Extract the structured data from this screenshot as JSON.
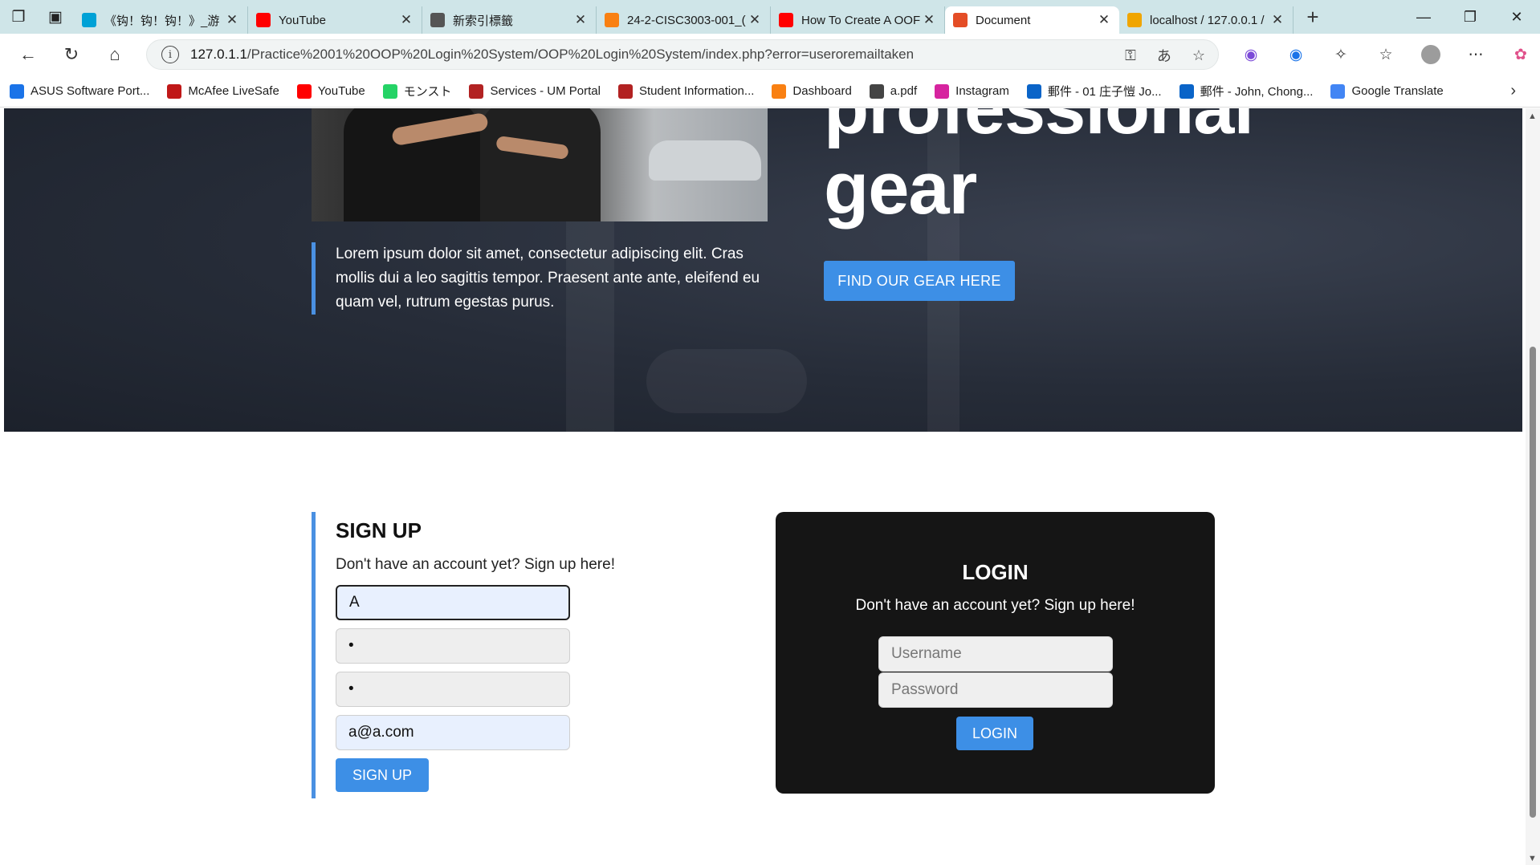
{
  "browser": {
    "tabs": [
      {
        "title": "《钩！钩！钩！》_游",
        "favicon": "bilibili-icon",
        "color": "#00a1d6"
      },
      {
        "title": "YouTube",
        "favicon": "youtube-icon",
        "color": "#ff0000"
      },
      {
        "title": "新索引標籤",
        "favicon": "newtab-icon",
        "color": "#555555"
      },
      {
        "title": "24-2-CISC3003-001_(",
        "favicon": "moodle-icon",
        "color": "#f98012"
      },
      {
        "title": "How To Create A OOF",
        "favicon": "youtube-icon",
        "color": "#ff0000"
      },
      {
        "title": "Document",
        "favicon": "html-icon",
        "color": "#e44d26"
      },
      {
        "title": "localhost / 127.0.0.1 /",
        "favicon": "phpmyadmin-icon",
        "color": "#f0a500"
      }
    ],
    "active_tab_index": 5,
    "url_host": "127.0.1.1",
    "url_path": "/Practice%2001%20OOP%20Login%20System/OOP%20Login%20System/index.php?error=useroremailtaken",
    "bookmarks": [
      {
        "label": "ASUS Software Port...",
        "icon": "asus-icon",
        "color": "#1a73e8"
      },
      {
        "label": "McAfee LiveSafe",
        "icon": "mcafee-icon",
        "color": "#c01818"
      },
      {
        "label": "YouTube",
        "icon": "youtube-icon",
        "color": "#ff0000"
      },
      {
        "label": "モンスト",
        "icon": "whatsapp-icon",
        "color": "#25d366"
      },
      {
        "label": "Services - UM Portal",
        "icon": "um-icon",
        "color": "#b22222"
      },
      {
        "label": "Student Information...",
        "icon": "um-icon",
        "color": "#b22222"
      },
      {
        "label": "Dashboard",
        "icon": "moodle-icon",
        "color": "#f98012"
      },
      {
        "label": "a.pdf",
        "icon": "globe-icon",
        "color": "#444444"
      },
      {
        "label": "Instagram",
        "icon": "instagram-icon",
        "color": "#d6249f"
      },
      {
        "label": "郵件 - 01 庄子愷 Jo...",
        "icon": "outlook-icon",
        "color": "#0a64c8"
      },
      {
        "label": "郵件 - John, Chong...",
        "icon": "outlook-icon",
        "color": "#0a64c8"
      },
      {
        "label": "Google Translate",
        "icon": "translate-icon",
        "color": "#4285f4"
      }
    ]
  },
  "hero": {
    "title_line1": "professional",
    "title_line2": "gear",
    "quote": "Lorem ipsum dolor sit amet, consectetur adipiscing elit. Cras mollis dui a leo sagittis tempor. Praesent ante ante, eleifend eu quam vel, rutrum egestas purus.",
    "cta_label": "FIND OUR GEAR HERE",
    "accent": "#3d8fe6"
  },
  "signup": {
    "heading": "SIGN UP",
    "subtext": "Don't have an account yet? Sign up here!",
    "username_value": "A",
    "password_value": "•",
    "repeat_password_value": "•",
    "email_value": "a@a.com",
    "button_label": "SIGN UP"
  },
  "login": {
    "heading": "LOGIN",
    "subtext": "Don't have an account yet? Sign up here!",
    "username_placeholder": "Username",
    "password_placeholder": "Password",
    "button_label": "LOGIN"
  }
}
